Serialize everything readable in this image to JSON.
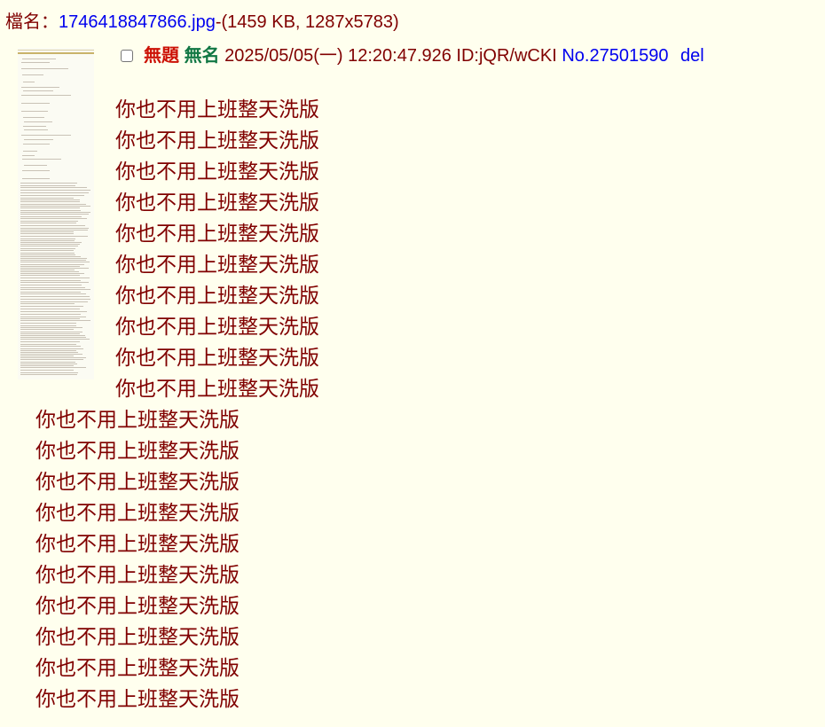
{
  "file": {
    "label": "檔名：",
    "link_text": "1746418847866.jpg",
    "info_text": "-(1459 KB, 1287x5783)"
  },
  "post": {
    "subject": "無題",
    "name": "無名",
    "datetime_id": "2025/05/05(一) 12:20:47.926 ID:jQR/wCKI",
    "number": "No.27501590",
    "del_label": "del"
  },
  "body": {
    "indented_lines": [
      "你也不用上班整天洗版",
      "你也不用上班整天洗版",
      "你也不用上班整天洗版",
      "你也不用上班整天洗版",
      "你也不用上班整天洗版",
      "你也不用上班整天洗版",
      "你也不用上班整天洗版",
      "你也不用上班整天洗版",
      "你也不用上班整天洗版",
      "你也不用上班整天洗版"
    ],
    "lines": [
      "你也不用上班整天洗版",
      "你也不用上班整天洗版",
      "你也不用上班整天洗版",
      "你也不用上班整天洗版",
      "你也不用上班整天洗版",
      "你也不用上班整天洗版",
      "你也不用上班整天洗版",
      "你也不用上班整天洗版",
      "你也不用上班整天洗版",
      "你也不用上班整天洗版"
    ]
  },
  "colors": {
    "background": "#FFFFEE",
    "text": "#800000",
    "link": "#0000EE",
    "subject": "#CC1105",
    "name": "#117743"
  }
}
